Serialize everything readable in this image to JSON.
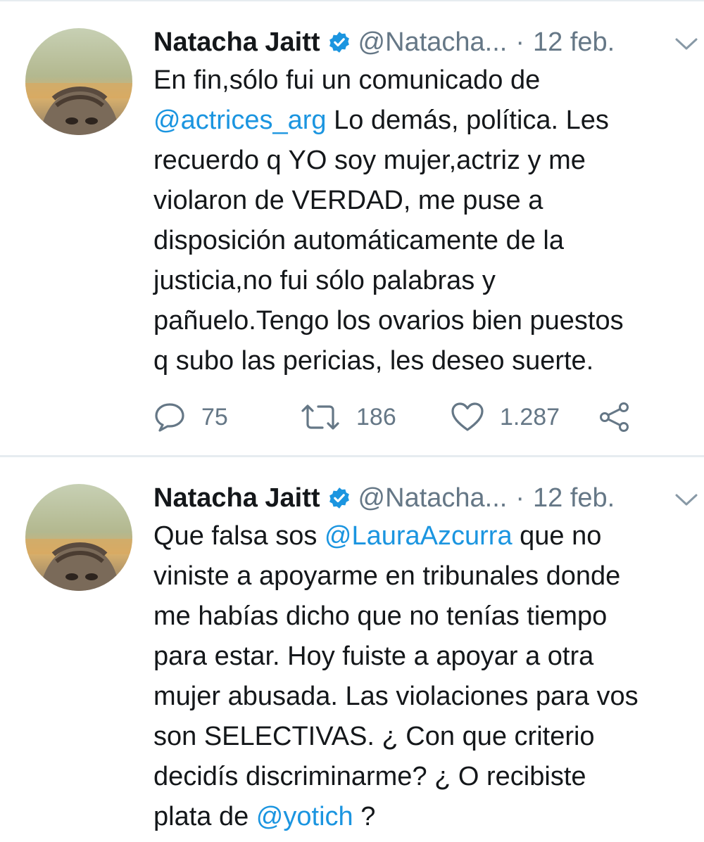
{
  "tweets": [
    {
      "author": {
        "name": "Natacha Jaitt",
        "handle": "@Natacha...",
        "verified": true
      },
      "separator": "·",
      "date": "12 feb.",
      "lines": [
        [
          {
            "t": "En fin,sólo fui un comunicado de"
          }
        ],
        [
          {
            "t": "@actrices_arg",
            "mention": true
          },
          {
            "t": " Lo demás, política. Les"
          }
        ],
        [
          {
            "t": "recuerdo q YO soy mujer,actriz y me"
          }
        ],
        [
          {
            "t": "violaron de VERDAD, me puse a"
          }
        ],
        [
          {
            "t": "disposición automáticamente de la"
          }
        ],
        [
          {
            "t": "justicia,no fui sólo palabras y"
          }
        ],
        [
          {
            "t": "pañuelo.Tengo los ovarios bien puestos"
          }
        ],
        [
          {
            "t": "q subo las pericias, les deseo suerte."
          }
        ]
      ],
      "stats": {
        "replies": "75",
        "retweets": "186",
        "likes": "1.287"
      }
    },
    {
      "author": {
        "name": "Natacha Jaitt",
        "handle": "@Natacha...",
        "verified": true
      },
      "separator": "·",
      "date": "12 feb.",
      "lines": [
        [
          {
            "t": "Que falsa sos "
          },
          {
            "t": "@LauraAzcurra",
            "mention": true
          },
          {
            "t": " que no"
          }
        ],
        [
          {
            "t": "viniste a apoyarme en tribunales donde"
          }
        ],
        [
          {
            "t": "me habías dicho que no tenías tiempo"
          }
        ],
        [
          {
            "t": "para estar. Hoy fuiste a apoyar a otra"
          }
        ],
        [
          {
            "t": "mujer abusada. Las violaciones para vos"
          }
        ],
        [
          {
            "t": "son SELECTIVAS. ¿ Con que criterio"
          }
        ],
        [
          {
            "t": "decidís discriminarme? ¿ O recibiste"
          }
        ],
        [
          {
            "t": "plata de "
          },
          {
            "t": "@yotich",
            "mention": true
          },
          {
            "t": " ?"
          }
        ]
      ]
    }
  ],
  "icons": {
    "verified": "verified-badge-icon",
    "more": "chevron-down-icon",
    "reply": "reply-icon",
    "retweet": "retweet-icon",
    "like": "heart-icon",
    "share": "share-icon"
  },
  "colors": {
    "text": "#14171a",
    "secondary": "#657786",
    "link": "#1b95e0",
    "divider": "#e6ecf0"
  }
}
